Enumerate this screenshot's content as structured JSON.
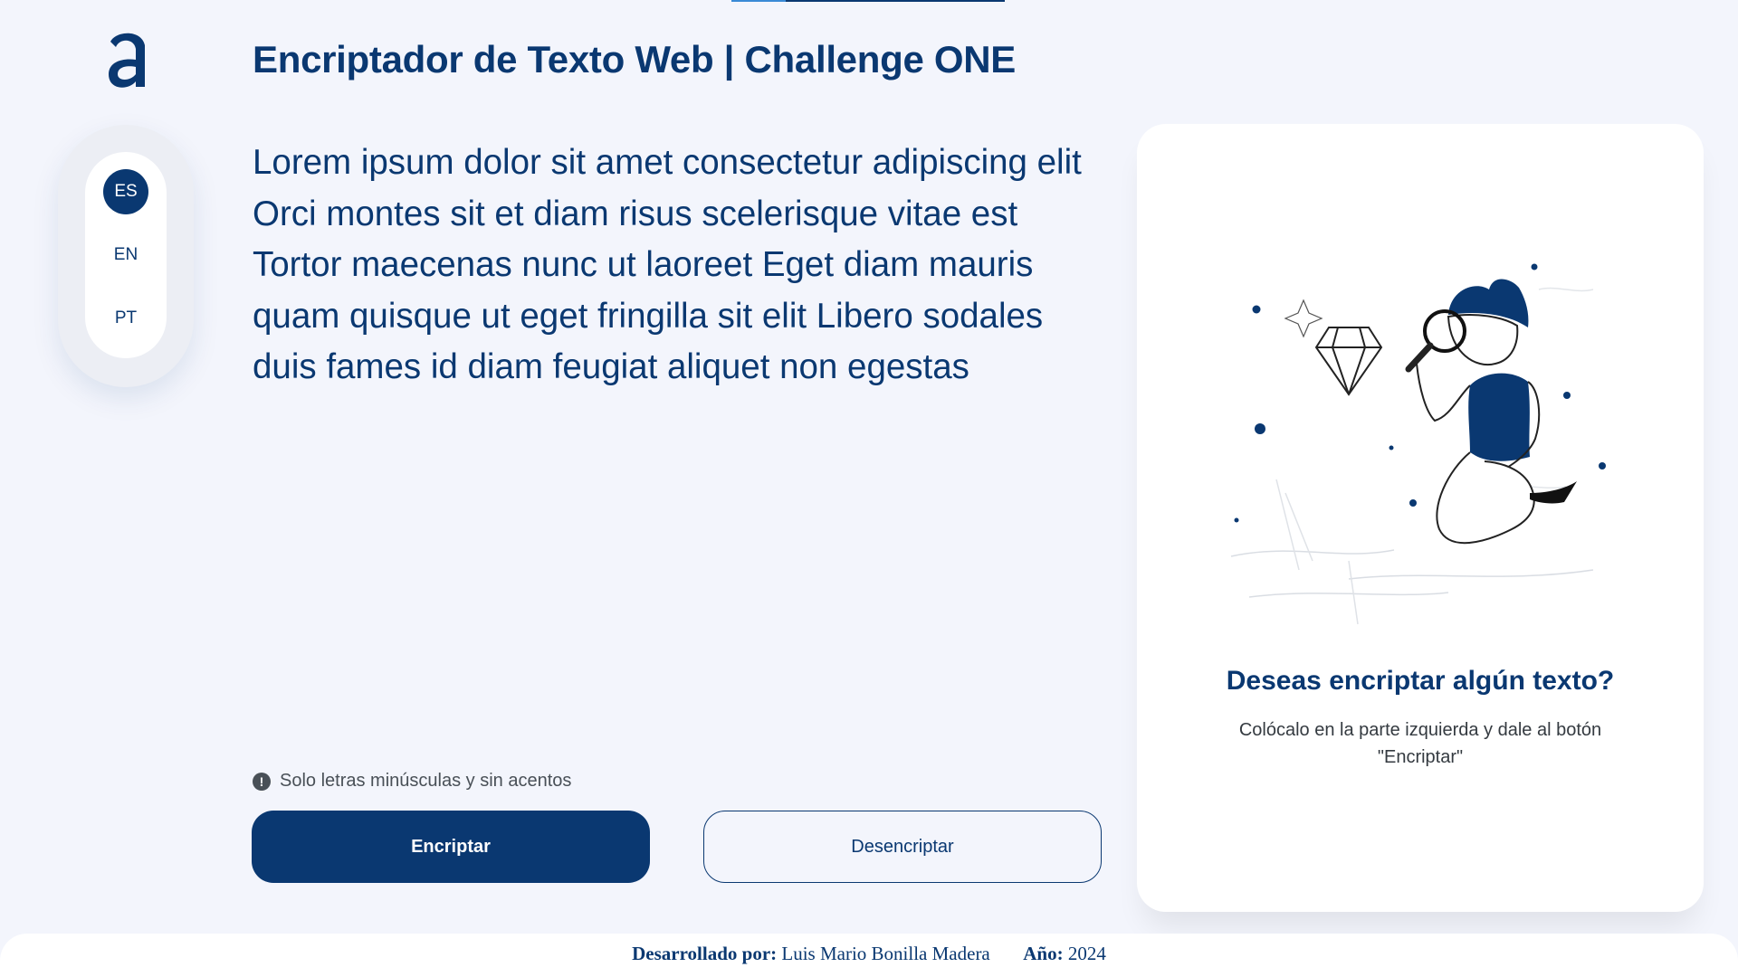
{
  "header": {
    "title": "Encriptador de Texto Web | Challenge ONE",
    "logo_icon": "alura-a-logo-icon"
  },
  "languages": [
    {
      "code": "ES",
      "active": true
    },
    {
      "code": "EN",
      "active": false
    },
    {
      "code": "PT",
      "active": false
    }
  ],
  "editor": {
    "value": "Lorem ipsum dolor sit amet consectetur adipiscing elit Orci montes sit et diam risus scelerisque vitae est Tortor maecenas nunc ut laoreet Eget diam mauris quam quisque ut eget fringilla sit elit Libero sodales duis fames id diam feugiat aliquet non egestas"
  },
  "hint": {
    "icon": "exclamation-circle-icon",
    "text": "Solo letras minúsculas y sin acentos"
  },
  "actions": {
    "encrypt_label": "Encriptar",
    "decrypt_label": "Desencriptar"
  },
  "output_panel": {
    "illustration": "person-inspecting-diamond-illustration",
    "title": "Deseas encriptar algún texto?",
    "message": "Colócalo en la parte izquierda y dale al botón \"Encriptar\""
  },
  "footer": {
    "developed_label": "Desarrollado por:",
    "developer": "Luis Mario Bonilla Madera",
    "year_label": "Año:",
    "year": "2024"
  },
  "colors": {
    "primary": "#0a3871",
    "background": "#f3f5fc",
    "panel": "#ffffff"
  }
}
